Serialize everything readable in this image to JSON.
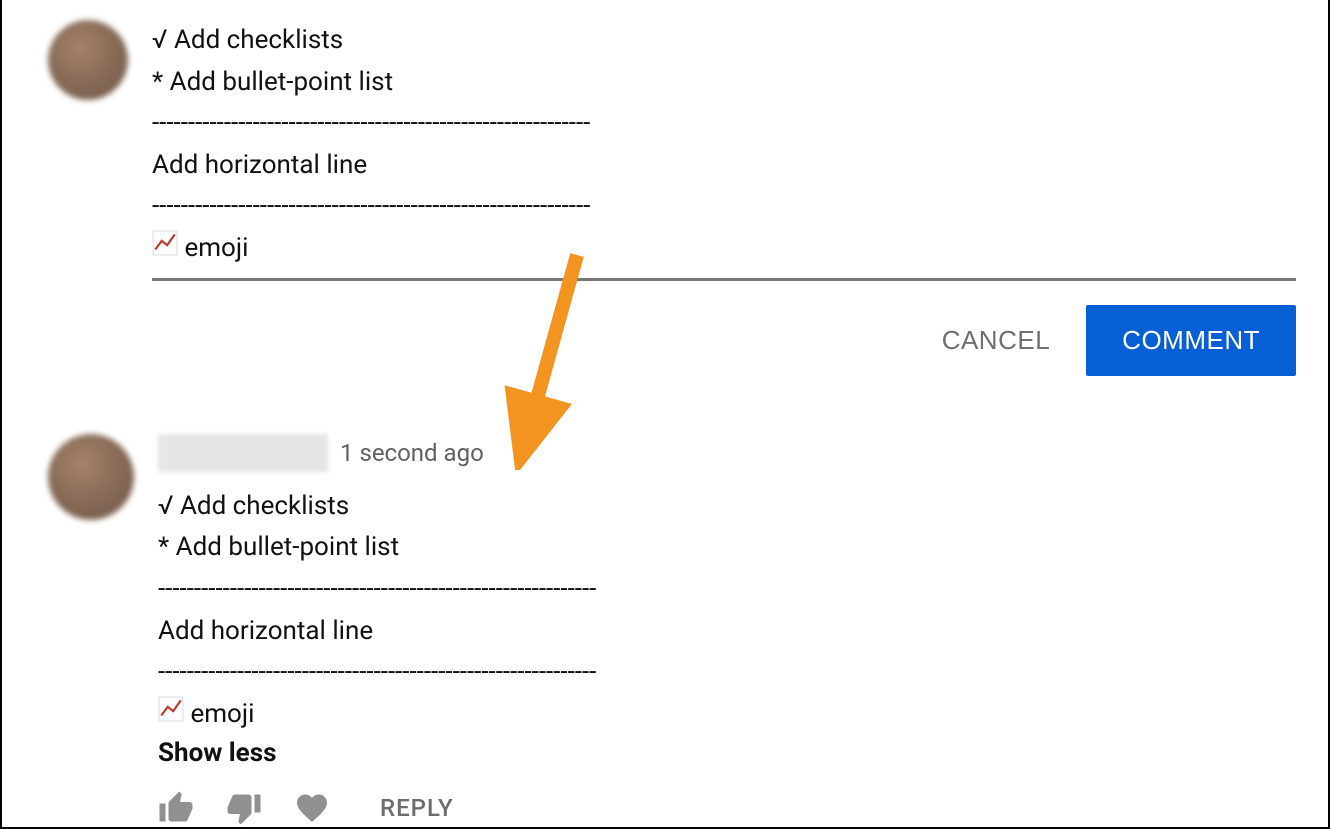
{
  "input_comment": {
    "lines": [
      "√ Add checklists",
      "* Add bullet-point list",
      "-------------------------------------------------------------",
      "Add horizontal line",
      "-------------------------------------------------------------",
      "📈 emoji"
    ]
  },
  "actions": {
    "cancel_label": "CANCEL",
    "comment_label": "COMMENT"
  },
  "posted_comment": {
    "timestamp": "1 second ago",
    "lines": [
      "√ Add checklists",
      "* Add bullet-point list",
      "-------------------------------------------------------------",
      "Add horizontal line",
      "-------------------------------------------------------------",
      "📈 emoji"
    ],
    "show_less_label": "Show less",
    "reply_label": "REPLY"
  },
  "colors": {
    "primary": "#065fd4",
    "arrow": "#f2941f",
    "muted": "#6f6f6f"
  }
}
